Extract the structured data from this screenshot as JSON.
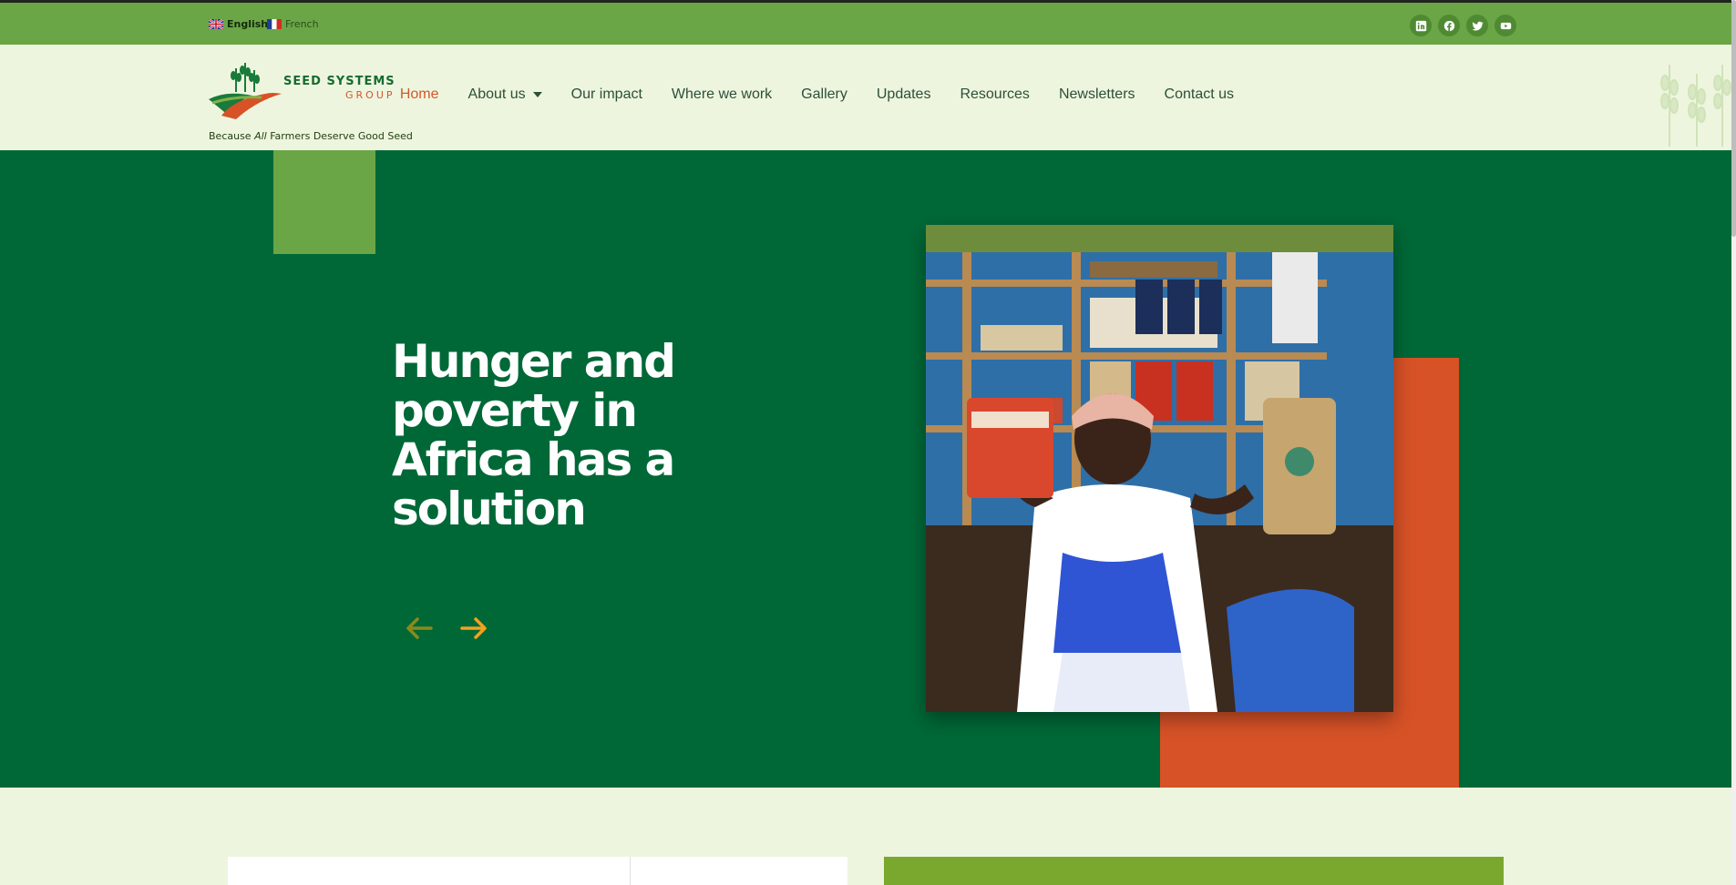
{
  "topbar": {
    "languages": [
      {
        "label": "English",
        "flag": "uk-flag-icon"
      },
      {
        "label": "French",
        "flag": "france-flag-icon"
      }
    ],
    "socials": [
      "linkedin-icon",
      "facebook-icon",
      "twitter-icon",
      "youtube-icon"
    ]
  },
  "header": {
    "logo_line1": "SEED SYSTEMS",
    "logo_line2": "GROUP",
    "tagline_pre": "Because ",
    "tagline_em": "All",
    "tagline_post": " Farmers Deserve Good Seed",
    "nav": {
      "home": "Home",
      "about": "About us",
      "impact": "Our impact",
      "where": "Where we work",
      "gallery": "Gallery",
      "updates": "Updates",
      "resources": "Resources",
      "newsletters": "Newsletters",
      "contact": "Contact us"
    }
  },
  "hero": {
    "title": "Hunger and poverty in Africa has a solution"
  },
  "colors": {
    "topbar": "#6aa546",
    "hero_bg": "#006837",
    "accent_orange": "#d75227",
    "nav_active": "#d1582d",
    "arrow": "#f2a21e"
  }
}
